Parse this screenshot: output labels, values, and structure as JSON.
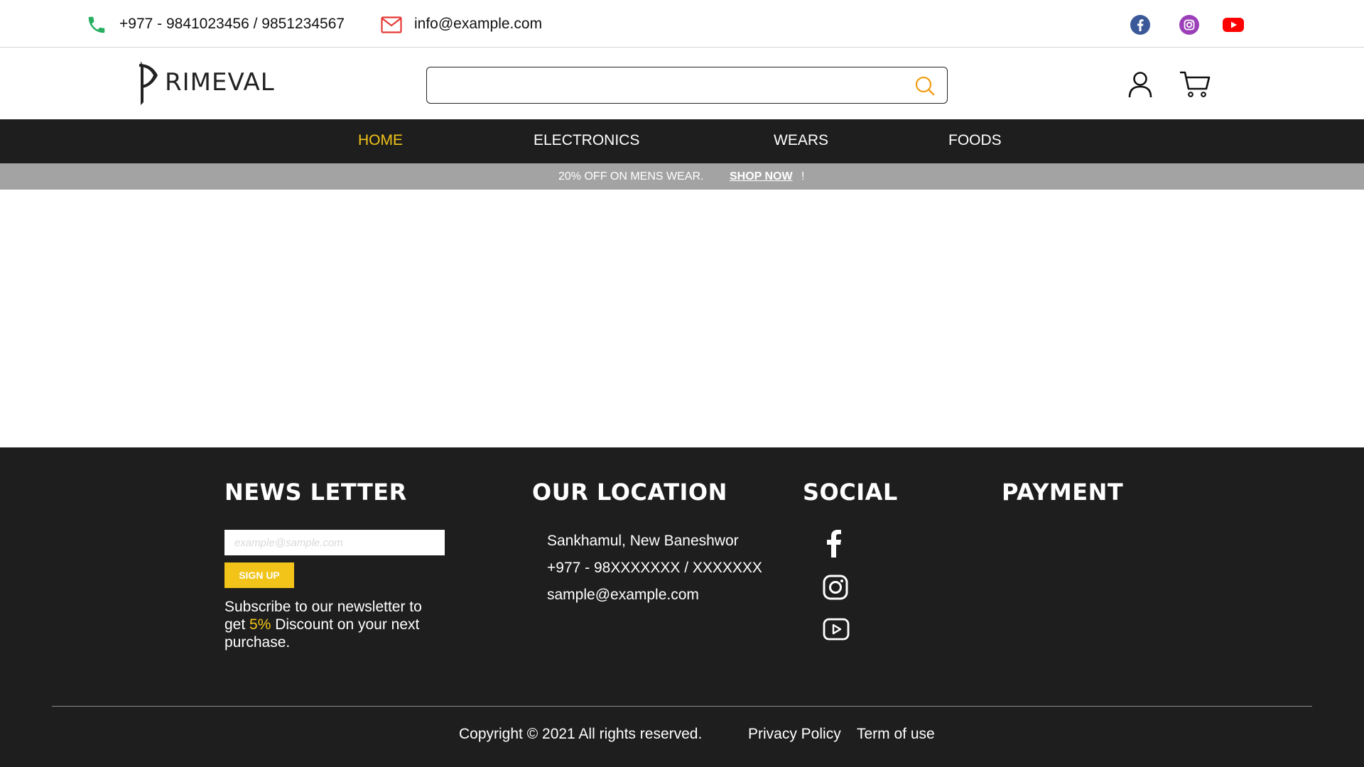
{
  "topbar": {
    "phone": "+977 - 9841023456 / 9851234567",
    "email": "info@example.com",
    "social_icons": [
      "facebook-icon",
      "instagram-icon",
      "youtube-icon"
    ]
  },
  "header": {
    "logo_text": "RIMEVAL",
    "search": {
      "value": "",
      "placeholder": ""
    },
    "icons": [
      "search-icon",
      "user-icon",
      "cart-icon"
    ]
  },
  "nav": {
    "items": [
      {
        "label": "HOME",
        "active": true
      },
      {
        "label": "ELECTRONICS",
        "active": false
      },
      {
        "label": "WEARS",
        "active": false
      },
      {
        "label": "FOODS",
        "active": false
      }
    ]
  },
  "promo": {
    "text": "20% OFF ON MENS WEAR.",
    "link": "SHOP NOW",
    "suffix": "!"
  },
  "footer": {
    "newsletter": {
      "heading": "NEWS LETTER",
      "input_placeholder": "example@sample.com",
      "button": "SIGN UP",
      "desc_pre": "Subscribe to our newsletter to get ",
      "desc_highlight": "5%",
      "desc_post": " Discount on your next purchase."
    },
    "location": {
      "heading": "OUR LOCATION",
      "address": "Sankhamul, New Baneshwor",
      "phone": "+977 - 98XXXXXXX / XXXXXXX",
      "email": "sample@example.com"
    },
    "social": {
      "heading": "SOCIAL",
      "icons": [
        "facebook-icon",
        "instagram-icon",
        "youtube-icon"
      ]
    },
    "payment": {
      "heading": "PAYMENT"
    },
    "copyright": "Copyright © 2021  All rights reserved.",
    "links": [
      "Privacy Policy",
      "Term of use"
    ]
  },
  "colors": {
    "accent": "#f2c318",
    "dark": "#1e1e1e",
    "promo_bg": "#a3a3a3",
    "phone_green": "#27ae60",
    "mail_red": "#e53935",
    "search_orange": "#f39c12",
    "facebook": "#3b5998",
    "instagram": "#9b3fb8",
    "youtube": "#ff0000"
  }
}
